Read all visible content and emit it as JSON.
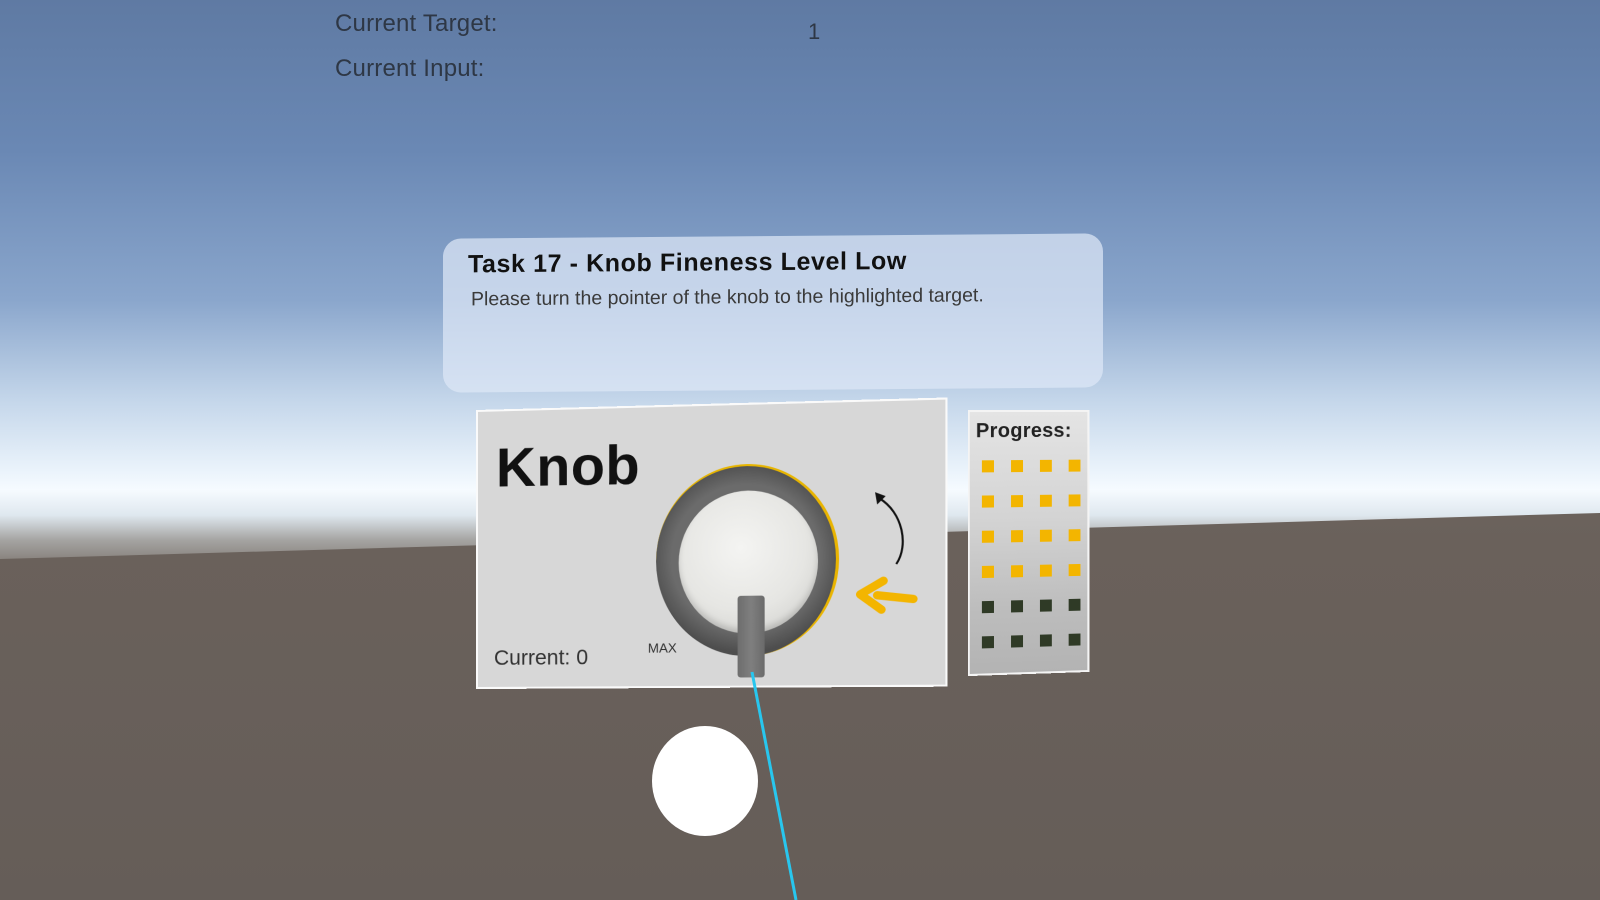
{
  "hud": {
    "target_label": "Current Target:",
    "target_value": "1",
    "input_label": "Current Input:"
  },
  "task": {
    "title": "Task 17 - Knob Fineness Level Low",
    "instruction": "Please turn the pointer of the knob to the highlighted target."
  },
  "knob_panel": {
    "title": "Knob",
    "current_label": "Current: 0",
    "max_label": "MAX",
    "ring_highlight_color": "#f3b500",
    "target_arrow_color": "#f3b500",
    "icons": [
      "rotate-counterclockwise-icon",
      "target-arrow-icon"
    ]
  },
  "progress": {
    "title": "Progress:",
    "completed": 16,
    "total": 24,
    "done_color": "#f3b500",
    "todo_color": "#2f3a26"
  }
}
